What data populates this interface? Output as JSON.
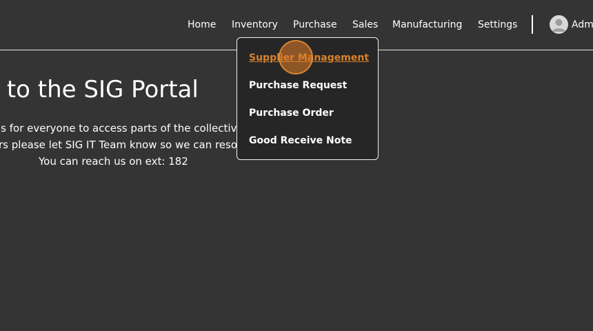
{
  "nav": {
    "items": [
      {
        "label": "Home"
      },
      {
        "label": "Inventory"
      },
      {
        "label": "Purchase"
      },
      {
        "label": "Sales"
      },
      {
        "label": "Manufacturing"
      },
      {
        "label": "Settings"
      }
    ],
    "user_name": "Adm",
    "avatar_icon": "user-avatar-icon"
  },
  "main": {
    "title": "me to the SIG Portal",
    "lines": [
      "is for everyone to access parts of the collective",
      "rs please let SIG IT Team know so we can resol",
      "You can reach us on ext: 182"
    ]
  },
  "purchase_menu": {
    "items": [
      {
        "label": "Supplier Management",
        "active": true
      },
      {
        "label": "Purchase Request"
      },
      {
        "label": "Purchase Order"
      },
      {
        "label": "Good Receive Note"
      }
    ],
    "active_color": "#d9822b"
  },
  "colors": {
    "background": "#343434",
    "menu_background": "#262626",
    "text": "#ffffff"
  }
}
